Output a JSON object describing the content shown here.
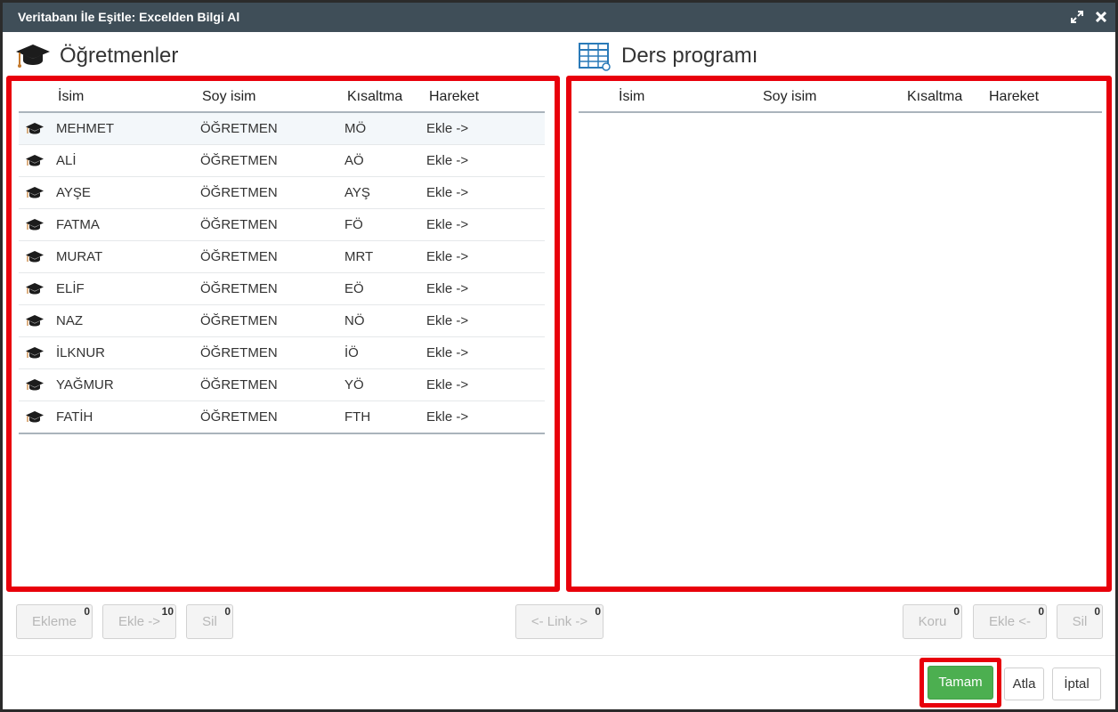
{
  "window": {
    "title": "Veritabanı İle Eşitle: Excelden Bilgi Al"
  },
  "left": {
    "title": "Öğretmenler",
    "icon": "graduation-cap-icon",
    "columns": [
      "İsim",
      "Soy isim",
      "Kısaltma",
      "Hareket"
    ],
    "rows": [
      {
        "name": "MEHMET",
        "surname": "ÖĞRETMEN",
        "short": "MÖ",
        "action": "Ekle ->"
      },
      {
        "name": "ALİ",
        "surname": "ÖĞRETMEN",
        "short": "AÖ",
        "action": "Ekle ->"
      },
      {
        "name": "AYŞE",
        "surname": "ÖĞRETMEN",
        "short": "AYŞ",
        "action": "Ekle ->"
      },
      {
        "name": "FATMA",
        "surname": "ÖĞRETMEN",
        "short": "FÖ",
        "action": "Ekle ->"
      },
      {
        "name": "MURAT",
        "surname": "ÖĞRETMEN",
        "short": "MRT",
        "action": "Ekle ->"
      },
      {
        "name": "ELİF",
        "surname": "ÖĞRETMEN",
        "short": "EÖ",
        "action": "Ekle ->"
      },
      {
        "name": "NAZ",
        "surname": "ÖĞRETMEN",
        "short": "NÖ",
        "action": "Ekle ->"
      },
      {
        "name": "İLKNUR",
        "surname": "ÖĞRETMEN",
        "short": "İÖ",
        "action": "Ekle ->"
      },
      {
        "name": "YAĞMUR",
        "surname": "ÖĞRETMEN",
        "short": "YÖ",
        "action": "Ekle ->"
      },
      {
        "name": "FATİH",
        "surname": "ÖĞRETMEN",
        "short": "FTH",
        "action": "Ekle ->"
      }
    ]
  },
  "right": {
    "title": "Ders programı",
    "icon": "table-grid-icon",
    "columns": [
      "İsim",
      "Soy isim",
      "Kısaltma",
      "Hareket"
    ]
  },
  "actions": {
    "left": [
      {
        "label": "Ekleme",
        "count": "0"
      },
      {
        "label": "Ekle ->",
        "count": "10"
      },
      {
        "label": "Sil",
        "count": "0"
      }
    ],
    "center": {
      "label": "<- Link ->",
      "count": "0"
    },
    "right": [
      {
        "label": "Koru",
        "count": "0"
      },
      {
        "label": "Ekle <-",
        "count": "0"
      },
      {
        "label": "Sil",
        "count": "0"
      }
    ]
  },
  "footer": {
    "ok": "Tamam",
    "skip": "Atla",
    "cancel": "İptal"
  },
  "colors": {
    "titlebar": "#3f4e58",
    "highlight_border": "#e8000b",
    "ok_button": "#4caf50"
  }
}
